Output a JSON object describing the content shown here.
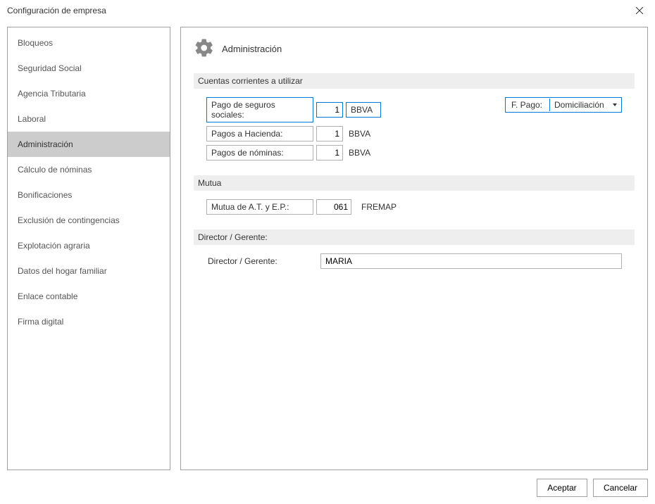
{
  "window": {
    "title": "Configuración de empresa"
  },
  "sidebar": {
    "items": [
      {
        "label": "Bloqueos"
      },
      {
        "label": "Seguridad Social"
      },
      {
        "label": "Agencia Tributaria"
      },
      {
        "label": "Laboral"
      },
      {
        "label": "Administración"
      },
      {
        "label": "Cálculo de nóminas"
      },
      {
        "label": "Bonificaciones"
      },
      {
        "label": "Exclusión de contingencias"
      },
      {
        "label": "Explotación agraria"
      },
      {
        "label": "Datos del hogar familiar"
      },
      {
        "label": "Enlace contable"
      },
      {
        "label": "Firma digital"
      }
    ],
    "selected_index": 4
  },
  "main": {
    "title": "Administración",
    "sections": {
      "accounts": {
        "header": "Cuentas corrientes a utilizar",
        "rows": [
          {
            "label": "Pago de seguros sociales:",
            "value": "1",
            "bank": "BBVA"
          },
          {
            "label": "Pagos a Hacienda:",
            "value": "1",
            "bank": "BBVA"
          },
          {
            "label": "Pagos de nóminas:",
            "value": "1",
            "bank": "BBVA"
          }
        ],
        "fpago": {
          "label": "F. Pago:",
          "value": "Domiciliación"
        }
      },
      "mutua": {
        "header": "Mutua",
        "label": "Mutua de A.T. y E.P.:",
        "value": "061",
        "name": "FREMAP"
      },
      "director": {
        "header": "Director / Gerente:",
        "label": "Director / Gerente:",
        "value": "MARIA"
      }
    }
  },
  "footer": {
    "accept": "Aceptar",
    "cancel": "Cancelar"
  }
}
